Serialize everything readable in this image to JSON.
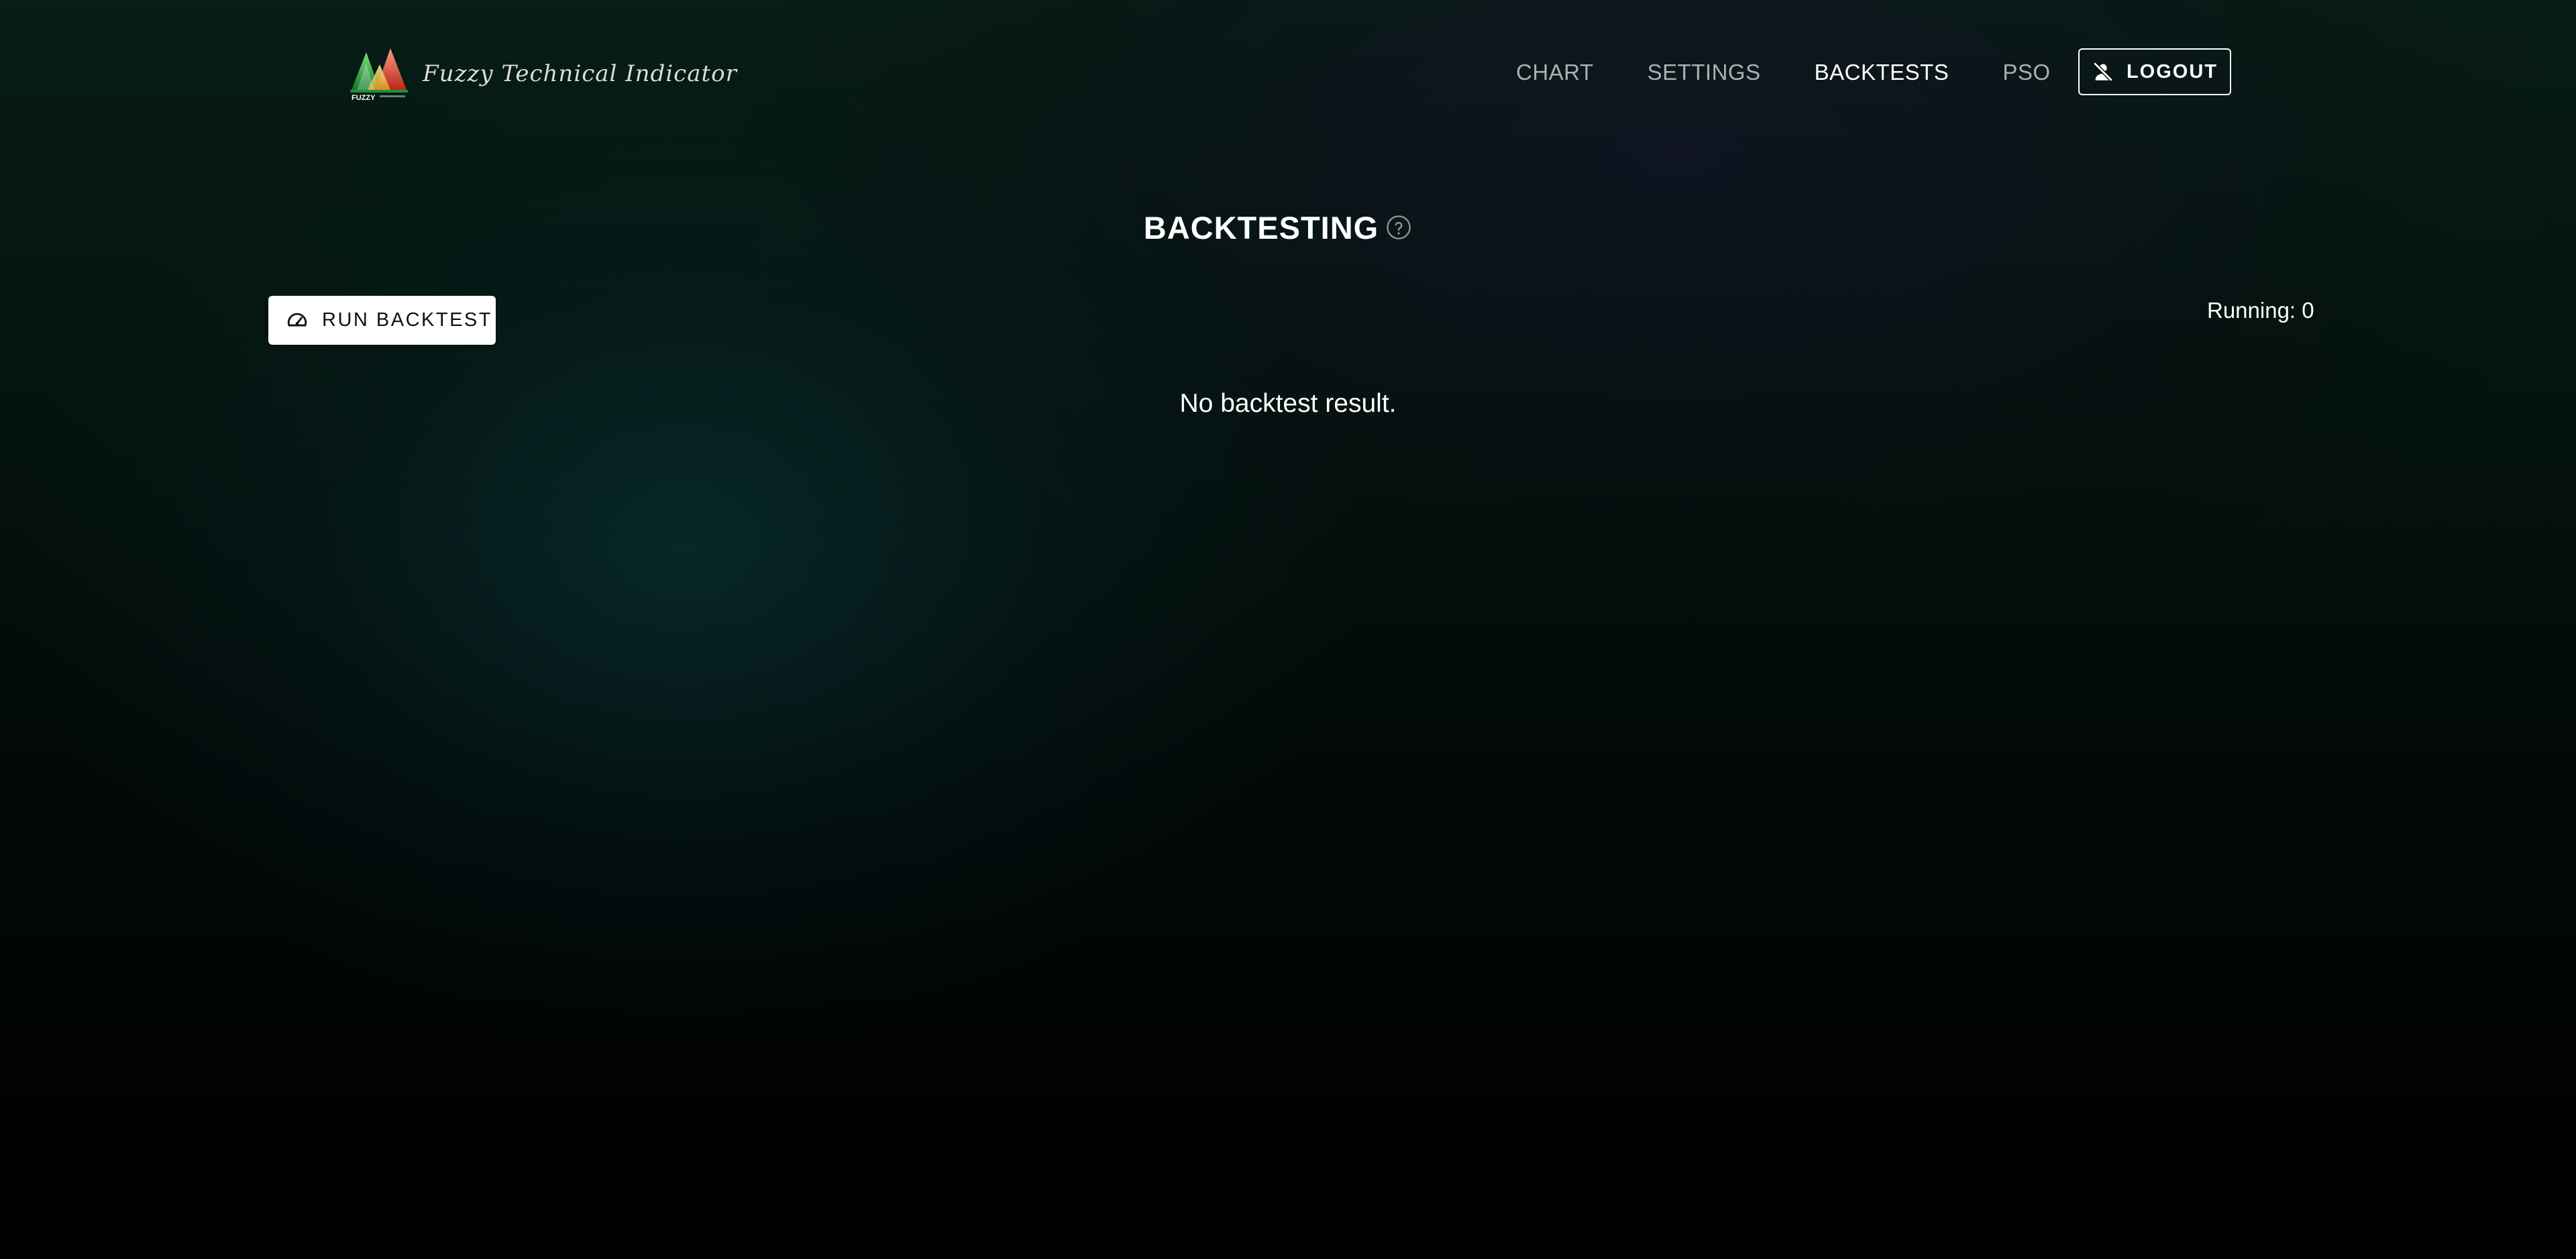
{
  "header": {
    "logo_text": "Fuzzy Technical Indicator",
    "logo_caption": "FUZZY",
    "nav": [
      {
        "label": "CHART",
        "active": false
      },
      {
        "label": "SETTINGS",
        "active": false
      },
      {
        "label": "BACKTESTS",
        "active": true
      },
      {
        "label": "PSO",
        "active": false
      }
    ],
    "logout_label": "LOGOUT",
    "logout_icon": "person-off-icon"
  },
  "main": {
    "title": "BACKTESTING",
    "help_icon": "question-circle-icon",
    "run_button_label": "RUN BACKTEST",
    "run_button_icon": "speedometer-icon",
    "running_status": "Running: 0",
    "empty_message": "No backtest result."
  },
  "colors": {
    "nav_inactive": "#a9b2ae",
    "nav_active": "#ffffff",
    "button_bg": "#ffffff",
    "background_top": "#071d15",
    "background_bottom": "#000000"
  }
}
